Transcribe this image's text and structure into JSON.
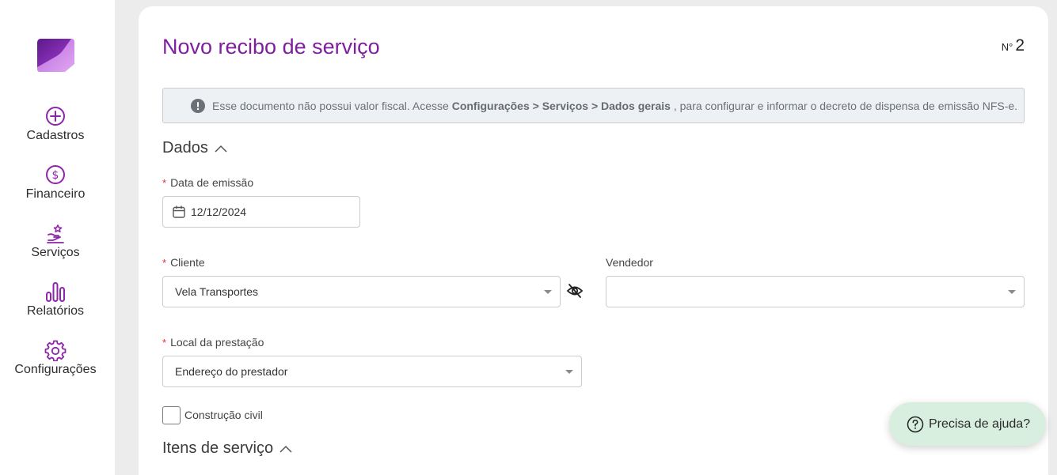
{
  "sidebar": {
    "items": [
      {
        "label": "Cadastros",
        "icon": "plus-circle-icon"
      },
      {
        "label": "Financeiro",
        "icon": "dollar-circle-icon"
      },
      {
        "label": "Serviços",
        "icon": "service-hand-star-icon"
      },
      {
        "label": "Relatórios",
        "icon": "bar-chart-icon"
      },
      {
        "label": "Configurações",
        "icon": "gear-icon"
      }
    ]
  },
  "header": {
    "title": "Novo recibo de serviço",
    "number_prefix": "N°",
    "number": "2"
  },
  "alert": {
    "text_before": "Esse documento não possui valor fiscal. Acesse ",
    "bold_path": "Configurações > Serviços > Dados gerais",
    "text_after": " , para configurar e informar o decreto de dispensa de emissão NFS-e."
  },
  "sections": {
    "dados": "Dados",
    "itens": "Itens de serviço"
  },
  "form": {
    "required_mark": "*",
    "data_emissao": {
      "label": "Data de emissão",
      "value": "12/12/2024"
    },
    "cliente": {
      "label": "Cliente",
      "value": "Vela Transportes"
    },
    "vendedor": {
      "label": "Vendedor",
      "value": ""
    },
    "local": {
      "label": "Local da prestação",
      "value": "Endereço do prestador"
    },
    "construcao": {
      "label": "Construção civil",
      "checked": false
    }
  },
  "help": {
    "label": "Precisa de ajuda?"
  },
  "colors": {
    "brand": "#7f1f9e",
    "icon_purple": "#8e24aa",
    "required": "#e0322e",
    "help_bg": "#d8efdf"
  }
}
